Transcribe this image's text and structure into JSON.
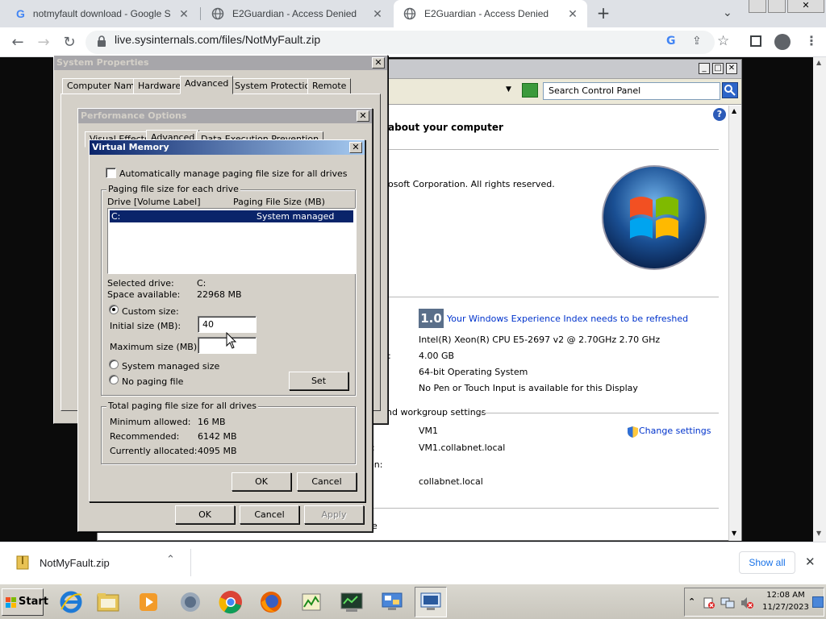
{
  "browser": {
    "tabs": [
      {
        "title": "notmyfault download - Google Sear",
        "icon": "google-g-icon"
      },
      {
        "title": "E2Guardian - Access Denied",
        "icon": "globe-icon"
      },
      {
        "title": "E2Guardian - Access Denied",
        "icon": "globe-icon"
      }
    ],
    "url": "live.sysinternals.com/files/NotMyFault.zip"
  },
  "control_panel": {
    "search_placeholder": "Search Control Panel",
    "heading": "about your computer",
    "copyright": "osoft Corporation.  All rights reserved.",
    "wei_score": "1.0",
    "wei_link": "Your Windows Experience Index needs to be refreshed",
    "processor": "Intel(R) Xeon(R) CPU E5-2697 v2 @ 2.70GHz   2.70 GHz",
    "memory_label": ":",
    "memory": "4.00 GB",
    "system_type": "64-bit Operating System",
    "pen_touch": "No Pen or Touch Input is available for this Display",
    "workgroup_heading": "nd workgroup settings",
    "computer_name": "VM1",
    "change_settings": "Change settings",
    "full_name_label": ":",
    "full_name": "VM1.collabnet.local",
    "description_label": "on:",
    "domain": "collabnet.local",
    "e_label": "e"
  },
  "system_properties": {
    "title": "System Properties",
    "tabs": [
      "Computer Name",
      "Hardware",
      "Advanced",
      "System Protection",
      "Remote"
    ],
    "ok": "OK",
    "cancel": "Cancel",
    "apply": "Apply"
  },
  "performance_options": {
    "title": "Performance Options",
    "tabs": [
      "Visual Effects",
      "Advanced",
      "Data Execution Prevention"
    ]
  },
  "virtual_memory": {
    "title": "Virtual Memory",
    "auto_manage": "Automatically manage paging file size for all drives",
    "group_each": "Paging file size for each drive",
    "col_drive": "Drive  [Volume Label]",
    "col_size": "Paging File Size (MB)",
    "drives": [
      {
        "drive": "C:",
        "size": "System managed"
      }
    ],
    "selected_drive_label": "Selected drive:",
    "selected_drive": "C:",
    "space_label": "Space available:",
    "space": "22968 MB",
    "custom_size": "Custom size:",
    "initial_label": "Initial size (MB):",
    "initial_value": "40",
    "max_label": "Maximum size (MB):",
    "max_value": "",
    "system_managed": "System managed size",
    "no_paging": "No paging file",
    "set": "Set",
    "group_total": "Total paging file size for all drives",
    "min_label": "Minimum allowed:",
    "min_value": "16 MB",
    "rec_label": "Recommended:",
    "rec_value": "6142 MB",
    "cur_label": "Currently allocated:",
    "cur_value": "4095 MB",
    "ok": "OK",
    "cancel": "Cancel"
  },
  "download": {
    "file": "NotMyFault.zip",
    "show_all": "Show all"
  },
  "taskbar": {
    "start": "Start",
    "time": "12:08 AM",
    "date": "11/27/2023"
  }
}
